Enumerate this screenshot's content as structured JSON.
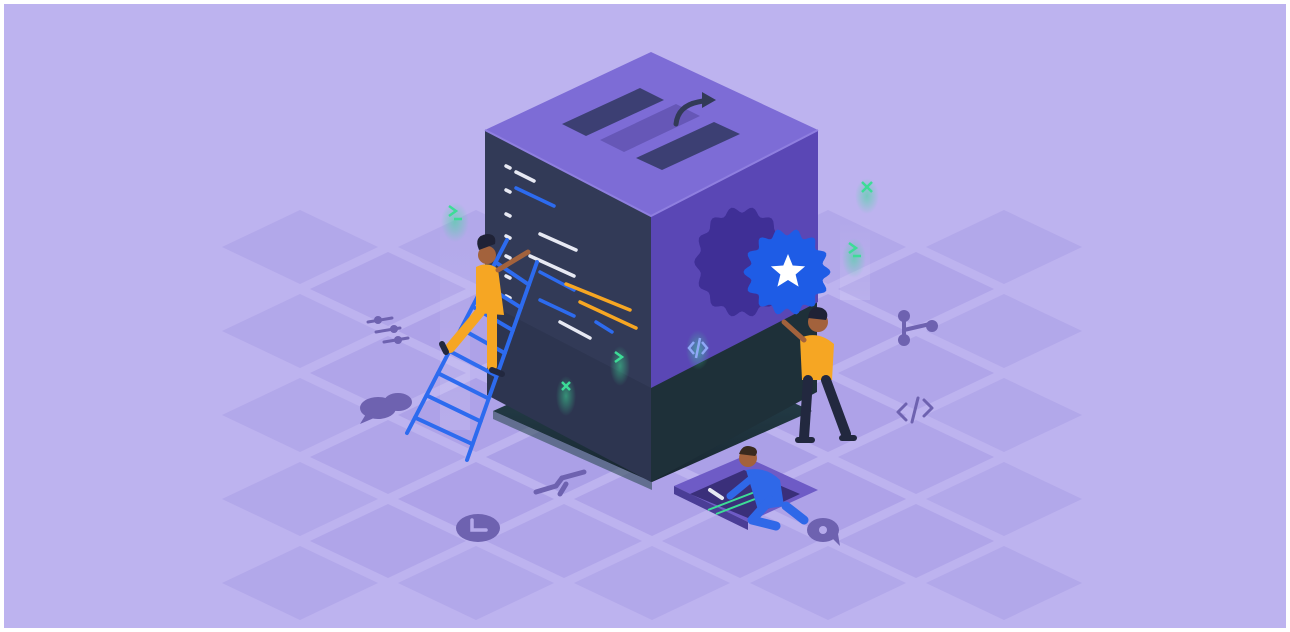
{
  "colors": {
    "background": "#BDB3EF",
    "frame": "#FFFFFF",
    "tile": "#A99DE6",
    "tile_light": "#B5AAEB",
    "tile_icon": "#6E62B0",
    "cube_top": "#7D6CD6",
    "cube_top_edge": "#8F7FE0",
    "cube_left": "#323A57",
    "cube_right": "#5A47B5",
    "hole_dark": "#1F3140",
    "hole_teal": "#3A6A6E",
    "badge_blue": "#1E5CE6",
    "badge_dark": "#3F2F96",
    "accent_orange": "#F6A623",
    "accent_green": "#3DDC97",
    "code_white": "#E7E9F3",
    "code_blue": "#2D6BEF",
    "skin": "#A3623C",
    "pants_dark": "#22283F",
    "shirt_blue": "#2F68E8"
  },
  "scene": {
    "cube_top_icons": [
      "minus-bar-icon",
      "arrow-curve-icon",
      "minus-bar-icon"
    ],
    "tile_icons": [
      "sliders-icon",
      "chat-bubbles-icon",
      "git-branch-icon",
      "code-brackets-icon",
      "commit-icon",
      "clock-icon",
      "comment-icon"
    ],
    "floating_icons": [
      "terminal-prompt-icon",
      "close-x-icon",
      "terminal-prompt-icon",
      "code-brackets-icon"
    ],
    "people": [
      "person-on-ladder",
      "person-holding-badge",
      "person-kneeling-with-wrench"
    ],
    "badge_icon": "star-icon"
  }
}
